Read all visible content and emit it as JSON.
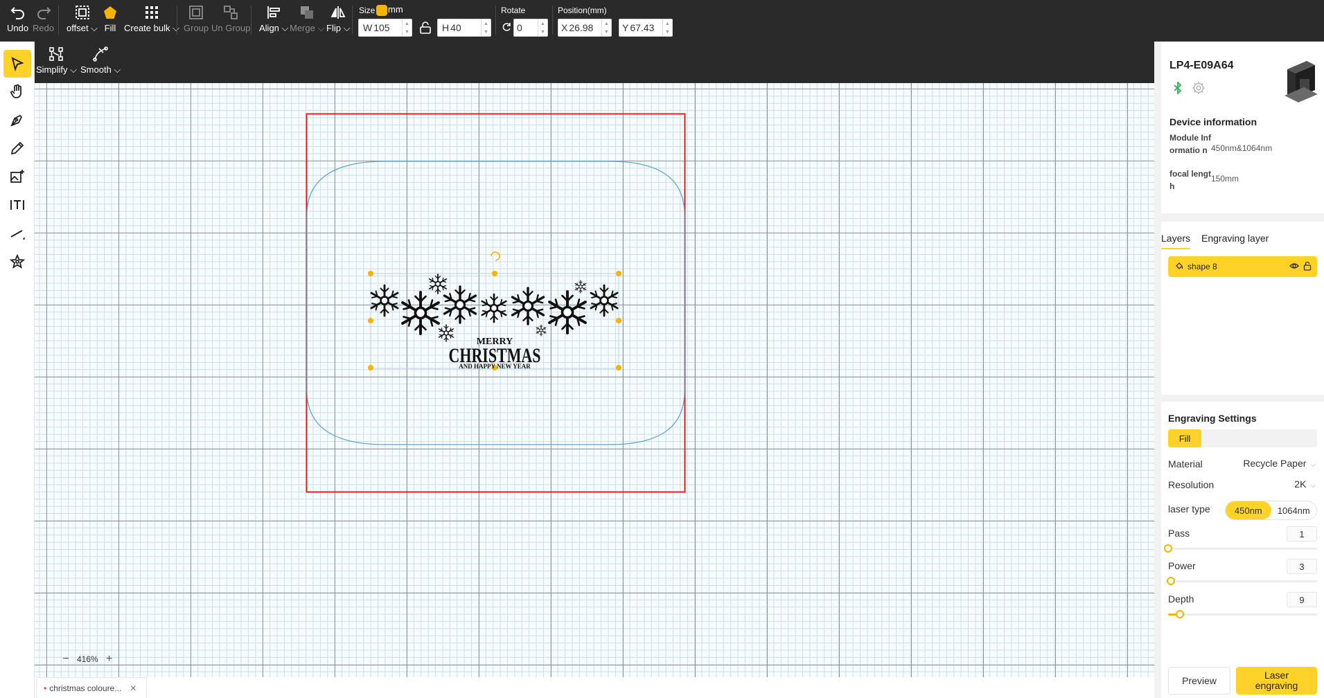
{
  "toolbar": {
    "undo": "Undo",
    "redo": "Redo",
    "offset": "offset",
    "fill": "Fill",
    "create_bulk": "Create bulk",
    "group": "Group",
    "ungroup": "Un Group",
    "align": "Align",
    "merge": "Merge",
    "flip": "Flip",
    "size_label": "Size",
    "unit": "mm",
    "width_prefix": "W",
    "width": "105",
    "height_prefix": "H",
    "height": "40",
    "rotate_label": "Rotate",
    "rotate": "0",
    "position_label": "Position(mm)",
    "x_prefix": "X",
    "x": "26.98",
    "y_prefix": "Y",
    "y": "67.43"
  },
  "subtoolbar": {
    "simplify": "Simplify",
    "smooth": "Smooth"
  },
  "canvas": {
    "design_line1": "MERRY",
    "design_line2": "CHRISTMAS",
    "design_line3": "AND HAPPY NEW YEAR",
    "zoom": "416%"
  },
  "file_tab": {
    "name": "christmas coloure..."
  },
  "device": {
    "name": "LP4-E09A64",
    "info_title": "Device information",
    "module_label": "Module Informatio n",
    "module_value": "450nm&1064nm",
    "focal_label": "focal length",
    "focal_value": "150mm"
  },
  "layers": {
    "tab_layers": "Layers",
    "tab_engraving": "Engraving layer",
    "items": [
      {
        "name": "shape 8"
      }
    ]
  },
  "engraving": {
    "title": "Engraving Settings",
    "mode": "Fill",
    "material_label": "Material",
    "material": "Recycle Paper",
    "resolution_label": "Resolution",
    "resolution": "2K",
    "laser_type_label": "laser type",
    "laser_options": [
      "450nm",
      "1064nm"
    ],
    "laser_selected": "450nm",
    "pass_label": "Pass",
    "pass": "1",
    "pass_level": 0.0,
    "power_label": "Power",
    "power": "3",
    "power_level": 0.02,
    "depth_label": "Depth",
    "depth": "9",
    "depth_level": 0.08,
    "preview": "Preview",
    "laser_engraving": "Laser engraving"
  },
  "colors": {
    "accent": "#ffd22a",
    "toolbar_bg": "#2a2a2a",
    "work_area_border": "#e02020",
    "bed_outline": "#5aa8d8"
  }
}
